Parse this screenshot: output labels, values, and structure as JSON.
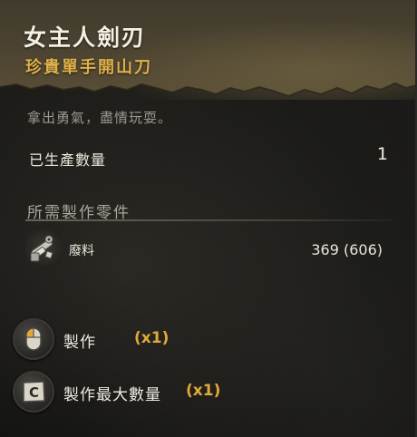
{
  "item": {
    "title": "女主人劍刃",
    "subtitle": "珍貴單手開山刀",
    "flavor": "拿出勇氣，盡情玩耍。"
  },
  "stats": {
    "produced_label": "已生產數量",
    "produced_value": "1"
  },
  "components": {
    "section_title": "所需製作零件",
    "items": [
      {
        "name": "廢料",
        "amount": "369 (606)",
        "icon": "scrap-parts-icon"
      }
    ]
  },
  "actions": [
    {
      "label": "製作",
      "multiplier": "(x1)",
      "key_icon": "mouse-button-icon"
    },
    {
      "label": "製作最大數量",
      "multiplier": "(x1)",
      "key": "C",
      "key_icon": "keyboard-c-key-icon"
    }
  ],
  "colors": {
    "title": "#f3efe2",
    "subtitle_gold": "#e1b24a",
    "multiplier_orange": "#e1a93a",
    "parchment": "#4a4230",
    "background": "#171715"
  }
}
